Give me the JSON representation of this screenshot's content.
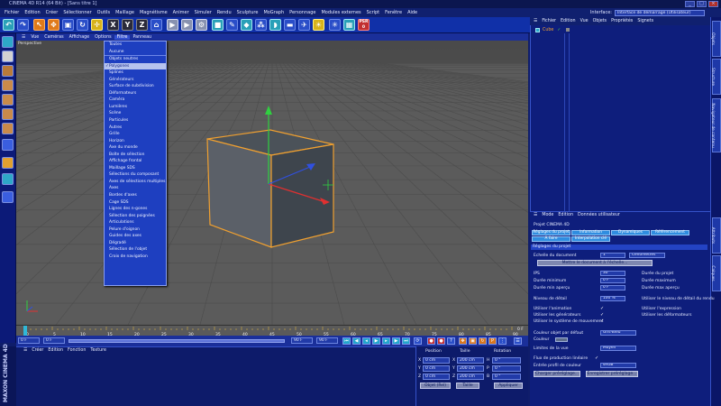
{
  "app": {
    "title": "CINEMA 4D R14 (64 Bit) - [Sans titre 1]",
    "window_buttons": [
      "_",
      "□",
      "×"
    ]
  },
  "menubar": [
    "Fichier",
    "Edition",
    "Créer",
    "Sélectionner",
    "Outils",
    "Maillage",
    "Magnétisme",
    "Animer",
    "Simuler",
    "Rendu",
    "Sculpture",
    "MoGraph",
    "Personnage",
    "Modules externes",
    "Script",
    "Fenêtre",
    "Aide"
  ],
  "interface": {
    "label": "Interface:",
    "value": "Interface de démarrage (Utilisateur)"
  },
  "toolbar": {
    "x_label": "X",
    "y_label": "Y",
    "z_label": "Z",
    "psr_label": "PSR",
    "psr_count": "0"
  },
  "viewport": {
    "menu": [
      "Vue",
      "Caméras",
      "Affichage",
      "Options",
      "Filtre",
      "Panneau"
    ],
    "active_menu": "Filtre",
    "label": "Perspective"
  },
  "filter_menu": {
    "items": [
      {
        "label": "Toutes"
      },
      {
        "label": "Aucune",
        "sep_after": true
      },
      {
        "label": "Objets neutres"
      },
      {
        "label": "Polygones",
        "checked": true,
        "selected": true
      },
      {
        "label": "Splines"
      },
      {
        "label": "Générateurs"
      },
      {
        "label": "Surface de subdivision"
      },
      {
        "label": "Déformateurs"
      },
      {
        "label": "Caméra"
      },
      {
        "label": "Lumières"
      },
      {
        "label": "Scène"
      },
      {
        "label": "Particules"
      },
      {
        "label": "Autres"
      },
      {
        "label": "Grille"
      },
      {
        "label": "Horizon"
      },
      {
        "label": "Axe du monde"
      },
      {
        "label": "Boîte de sélection"
      },
      {
        "label": "Affichage frontal"
      },
      {
        "label": "Maillage SDS"
      },
      {
        "label": "Sélections du composant"
      },
      {
        "label": "Axes de sélections multiples"
      },
      {
        "label": "Axes"
      },
      {
        "label": "Bordes d'axes"
      },
      {
        "label": "Cage SDS"
      },
      {
        "label": "Lignes des n-gones"
      },
      {
        "label": "Sélection des poignées"
      },
      {
        "label": "Articulations"
      },
      {
        "label": "Pelure d'oignon"
      },
      {
        "label": "Guides des axes"
      },
      {
        "label": "Dégradé"
      },
      {
        "label": "Sélection de l'objet"
      },
      {
        "label": "Croix de navigation"
      }
    ]
  },
  "timeline": {
    "ticks": [
      "0",
      "5",
      "10",
      "15",
      "20",
      "25",
      "30",
      "35",
      "40",
      "45",
      "50",
      "55",
      "60",
      "65",
      "70",
      "75",
      "80",
      "85",
      "90"
    ],
    "current_frame": "0 F",
    "start_field": "0 F",
    "end_field": "90 F",
    "end_field2": "90 F",
    "frame_field": "0 F",
    "range_label": "0 F"
  },
  "material_manager": {
    "menu": [
      "Créer",
      "Edition",
      "Fonction",
      "Texture"
    ]
  },
  "brand": {
    "text": "MAXON CINEMA 4D"
  },
  "coordinates": {
    "headers": [
      "Position",
      "Taille",
      "Rotation"
    ],
    "rows": [
      {
        "axis": "X",
        "pos": "0 cm",
        "size_axis": "X",
        "size": "200 cm",
        "rot_axis": "H",
        "rot": "0 °"
      },
      {
        "axis": "Y",
        "pos": "0 cm",
        "size_axis": "Y",
        "size": "200 cm",
        "rot_axis": "P",
        "rot": "0 °"
      },
      {
        "axis": "Z",
        "pos": "0 cm",
        "size_axis": "Z",
        "size": "200 cm",
        "rot_axis": "B",
        "rot": "0 °"
      }
    ],
    "mode_select": "Objet (Rel)",
    "size_select": "Taille",
    "apply_button": "Appliquer"
  },
  "object_manager": {
    "menu": [
      "Fichier",
      "Edition",
      "Vue",
      "Objets",
      "Propriétés",
      "Signets"
    ],
    "object_name": "Cube"
  },
  "right_tabs": [
    "Objets",
    "Structure",
    "Navigateur de contenu",
    "Attributs",
    "Calques"
  ],
  "attribute_manager": {
    "menu": [
      "Mode",
      "Edition",
      "Données utilisateur"
    ],
    "project_title": "Projet CINEMA 4D",
    "tabs_row1": [
      "Réglages du projet",
      "Information",
      "Dynamiques",
      "Référencement"
    ],
    "tabs_row2": [
      "A faire",
      "Interpolation clé"
    ],
    "section": "Réglages du projet",
    "scale_label": "Echelle du document",
    "scale_value": "1",
    "scale_unit": "Centimètres",
    "scale_button": "Mettre le document à l'échelle...",
    "left_rows": [
      {
        "label": "IPS",
        "value": "30"
      },
      {
        "label": "Durée minimum",
        "value": "0 F"
      },
      {
        "label": "Durée min aperçu",
        "value": "0 F"
      }
    ],
    "right_rows": [
      "Durée du projet",
      "Durée maximum",
      "Durée max aperçu"
    ],
    "detail_label": "Niveau de détail",
    "detail_value": "100 %",
    "detail_right": "Utiliser le niveau de détail du rendu",
    "left_checks": [
      "Utiliser l'animation",
      "Utiliser les générateurs",
      "Utiliser le système de mouvement"
    ],
    "right_checks": [
      "Utiliser l'expression",
      "Utiliser les déformateurs"
    ],
    "color_label": "Couleur objet par défaut",
    "color_value": "Gris-Bleu",
    "couleur_label": "Couleur",
    "units_label": "Limites de la vue",
    "units_value": "Moyen",
    "linear_label": "Flux de production linéaire",
    "profile_label": "Entrée profil de couleur",
    "profile_value": "sRGB",
    "load_button": "Charger préréglage...",
    "save_button": "Enregistrer préréglage..."
  },
  "colors": {
    "ui_blue": "#1030a8",
    "viewport_bg": "#5c5c5c",
    "selection_orange": "#f0a030",
    "axis_y": "#30d040",
    "axis_x": "#e03030",
    "axis_z": "#3050e0"
  }
}
